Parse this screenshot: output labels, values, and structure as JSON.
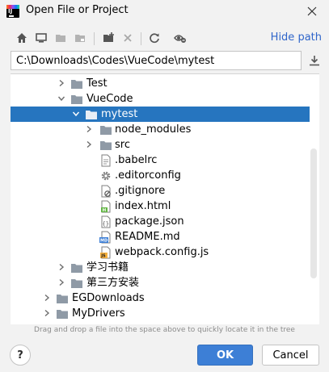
{
  "window": {
    "title": "Open File or Project"
  },
  "toolbar": {
    "hide_path_label": "Hide path"
  },
  "path": {
    "value": "C:\\Downloads\\Codes\\VueCode\\mytest"
  },
  "tree": {
    "items": [
      {
        "label": "Test",
        "type": "folder",
        "expanded": false
      },
      {
        "label": "VueCode",
        "type": "folder",
        "expanded": true
      },
      {
        "label": "mytest",
        "type": "folder",
        "expanded": true,
        "selected": true
      },
      {
        "label": "node_modules",
        "type": "folder",
        "expanded": false
      },
      {
        "label": "src",
        "type": "folder",
        "expanded": false
      },
      {
        "label": ".babelrc",
        "type": "file"
      },
      {
        "label": ".editorconfig",
        "type": "file"
      },
      {
        "label": ".gitignore",
        "type": "file"
      },
      {
        "label": "index.html",
        "type": "file"
      },
      {
        "label": "package.json",
        "type": "file"
      },
      {
        "label": "README.md",
        "type": "file"
      },
      {
        "label": "webpack.config.js",
        "type": "file"
      },
      {
        "label": "学习书籍",
        "type": "folder",
        "expanded": false
      },
      {
        "label": "第三方安装",
        "type": "folder",
        "expanded": false
      },
      {
        "label": "EGDownloads",
        "type": "folder",
        "expanded": false
      },
      {
        "label": "MyDrivers",
        "type": "folder",
        "expanded": false
      }
    ]
  },
  "hint": "Drag and drop a file into the space above to quickly locate it in the tree",
  "buttons": {
    "help": "?",
    "ok": "OK",
    "cancel": "Cancel"
  },
  "colors": {
    "selection": "#2675bf",
    "link": "#2f65ca",
    "primary_button": "#3d7fd6",
    "folder": "#8f9aa6"
  }
}
